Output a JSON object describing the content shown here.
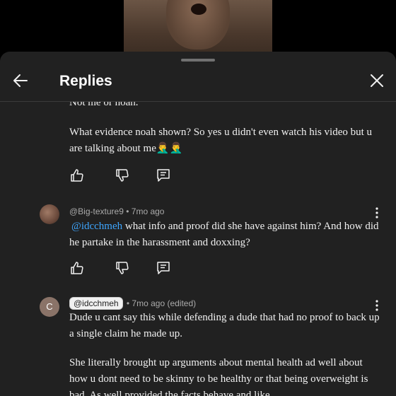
{
  "header": {
    "title": "Replies"
  },
  "thread": {
    "partial_line": "Not me or noah.",
    "first_text": "What evidence noah shown? So yes u didn't even watch his video but u are talking about me",
    "first_emoji": "🤦‍♂️🤦‍♂️"
  },
  "comments": [
    {
      "author": "@Big-texture9",
      "time": "• 7mo ago",
      "mention": "@idcchmeh",
      "text": " what info and proof did she have against him? And how did he partake in the harassment and doxxing?"
    },
    {
      "author": "@idcchmeh",
      "avatar_letter": "C",
      "time": "• 7mo ago (edited)",
      "text1": "Dude u cant say this while defending a dude that had no proof to back up a single claim he made up.",
      "text2": "She literally brought up arguments about mental health ad well about how u dont need to be skinny to be healthy or that being overweight is bad. As well provided the facts behave and like"
    }
  ],
  "colors": {
    "sheet_bg": "#212121",
    "mention": "#3ea6ff",
    "meta": "#aaaaaa"
  },
  "icons": {
    "back": "arrow-left-icon",
    "close": "close-icon",
    "like": "thumbs-up-icon",
    "dislike": "thumbs-down-icon",
    "reply": "reply-icon",
    "more": "more-vert-icon"
  }
}
